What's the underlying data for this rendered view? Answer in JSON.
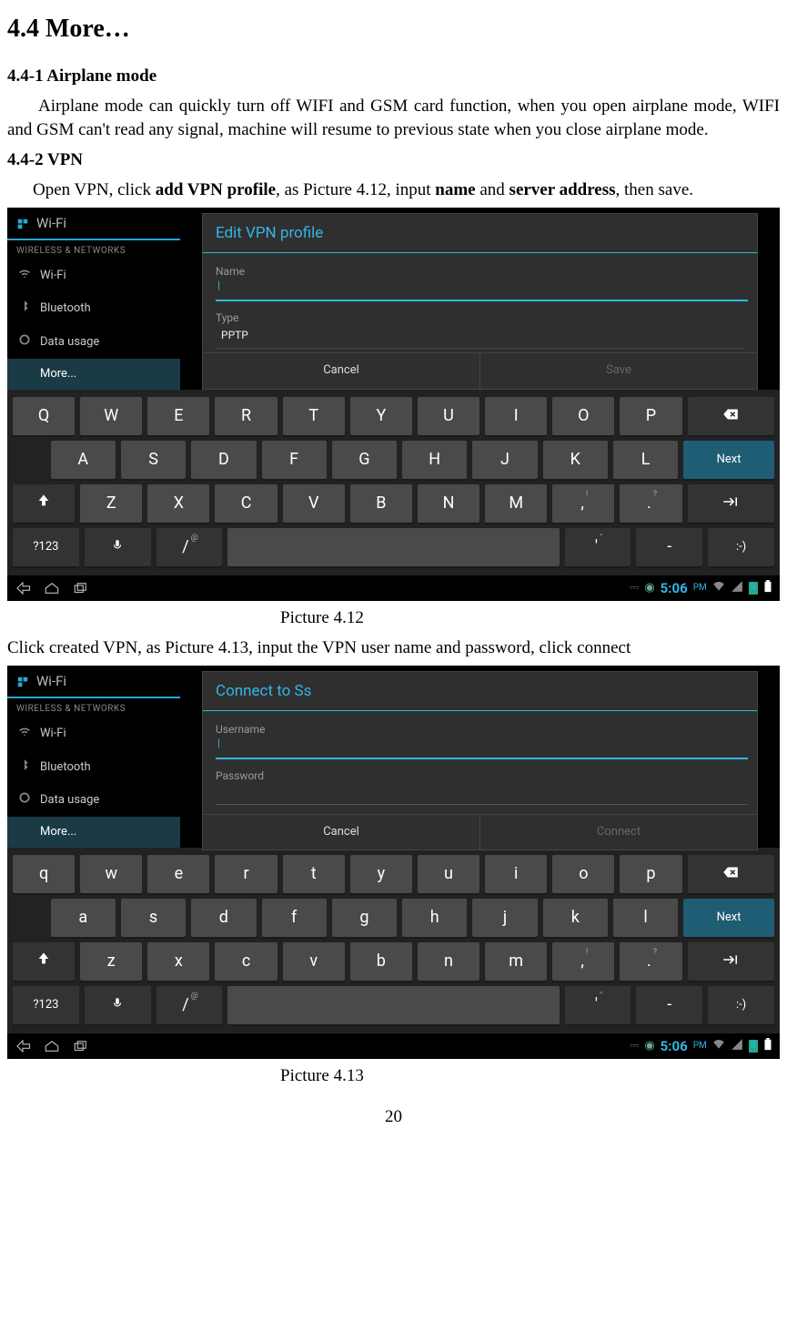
{
  "section_title": "4.4 More…",
  "sub1_title": "4.4-1 Airplane mode",
  "sub1_body": "Airplane mode can quickly turn off WIFI and GSM card function, when you open airplane mode, WIFI and GSM can't read any signal, machine will resume to previous state when you close airplane mode.",
  "sub2_title": "4.4-2 VPN",
  "sub2_body_1": "Open VPN, click ",
  "sub2_bold_1": "add VPN profile",
  "sub2_body_2": ", as Picture 4.12, input ",
  "sub2_bold_2": "name",
  "sub2_body_3": " and ",
  "sub2_bold_3": "server address",
  "sub2_body_4": ", then save.",
  "caption1": "Picture 4.12",
  "mid_text": "Click created VPN, as Picture 4.13, input the VPN user name and password, click connect",
  "caption2": "Picture 4.13",
  "pagenum": "20",
  "shot1": {
    "header_label": "Wi-Fi",
    "cat": "WIRELESS & NETWORKS",
    "items": [
      "Wi-Fi",
      "Bluetooth",
      "Data usage",
      "More..."
    ],
    "dlg_title": "Edit VPN profile",
    "lbl_name": "Name",
    "lbl_type": "Type",
    "val_type": "PPTP",
    "btn_cancel": "Cancel",
    "btn_save": "Save",
    "row1": [
      "Q",
      "W",
      "E",
      "R",
      "T",
      "Y",
      "U",
      "I",
      "O",
      "P"
    ],
    "row2": [
      "A",
      "S",
      "D",
      "F",
      "G",
      "H",
      "J",
      "K",
      "L"
    ],
    "row3": [
      "Z",
      "X",
      "C",
      "V",
      "B",
      "N",
      "M",
      ",",
      "."
    ],
    "row3_sup": [
      "",
      "",
      "",
      "",
      "",
      "",
      "",
      "!",
      "?"
    ],
    "next": "Next",
    "sym": "?123",
    "slash": "/",
    "slash_sup": "@",
    "apos": "'",
    "apos_sup": "\"",
    "dash": "-",
    "smile": ":-)",
    "time": "5:06",
    "pm": "PM"
  },
  "shot2": {
    "header_label": "Wi-Fi",
    "cat": "WIRELESS & NETWORKS",
    "items": [
      "Wi-Fi",
      "Bluetooth",
      "Data usage",
      "More..."
    ],
    "dlg_title": "Connect to Ss",
    "lbl_user": "Username",
    "lbl_pass": "Password",
    "btn_cancel": "Cancel",
    "btn_connect": "Connect",
    "row1": [
      "q",
      "w",
      "e",
      "r",
      "t",
      "y",
      "u",
      "i",
      "o",
      "p"
    ],
    "row2": [
      "a",
      "s",
      "d",
      "f",
      "g",
      "h",
      "j",
      "k",
      "l"
    ],
    "row3": [
      "z",
      "x",
      "c",
      "v",
      "b",
      "n",
      "m",
      ",",
      "."
    ],
    "row3_sup": [
      "",
      "",
      "",
      "",
      "",
      "",
      "",
      "!",
      "?"
    ],
    "next": "Next",
    "sym": "?123",
    "slash": "/",
    "slash_sup": "@",
    "apos": "'",
    "apos_sup": "\"",
    "dash": "-",
    "smile": ":-)",
    "time": "5:06",
    "pm": "PM"
  }
}
